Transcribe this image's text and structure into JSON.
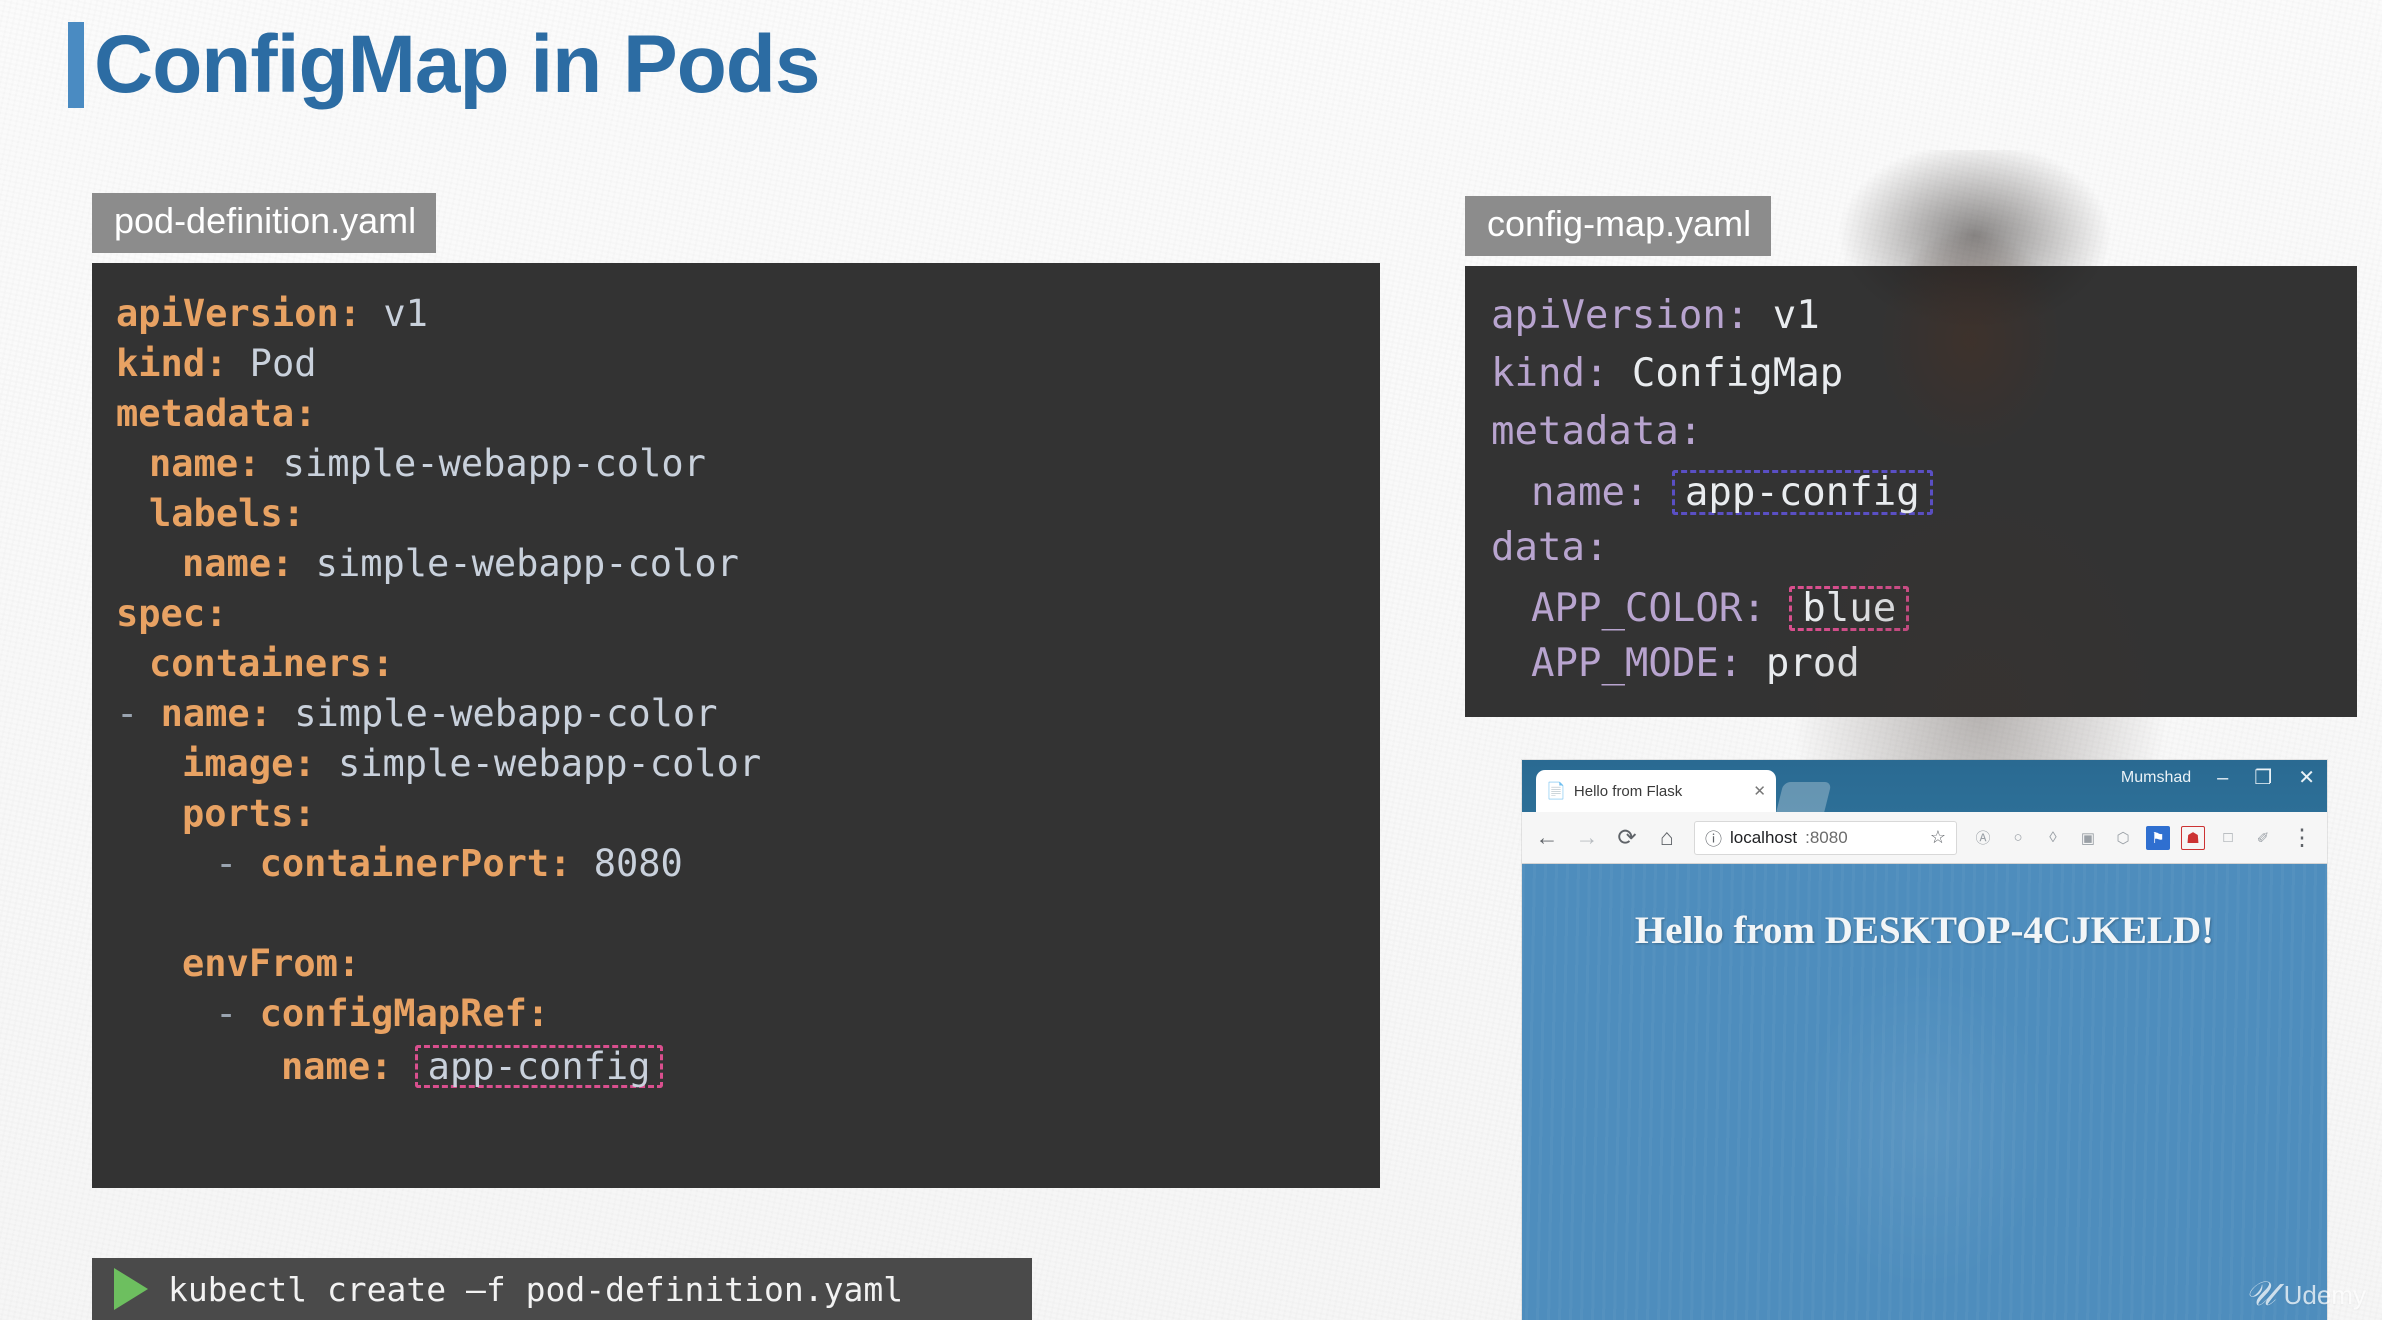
{
  "page_title": "ConfigMap in Pods",
  "accent_color": "#2c6ca3",
  "accent_bar_color": "#4a8bc2",
  "pod_file": {
    "tab_label": "pod-definition.yaml",
    "lines": [
      {
        "indent": 0,
        "dash": "",
        "key": "apiVersion:",
        "value": "v1"
      },
      {
        "indent": 0,
        "dash": "",
        "key": "kind:",
        "value": "Pod"
      },
      {
        "indent": 0,
        "dash": "",
        "key": "metadata:",
        "value": ""
      },
      {
        "indent": 1,
        "dash": "",
        "key": "name:",
        "value": "simple-webapp-color"
      },
      {
        "indent": 1,
        "dash": "",
        "key": "labels:",
        "value": ""
      },
      {
        "indent": 2,
        "dash": "",
        "key": "name:",
        "value": "simple-webapp-color"
      },
      {
        "indent": 0,
        "dash": "",
        "key": "spec:",
        "value": ""
      },
      {
        "indent": 1,
        "dash": "",
        "key": "containers:",
        "value": ""
      },
      {
        "indent": 0,
        "dash": "-",
        "key": "name:",
        "value": "simple-webapp-color"
      },
      {
        "indent": 2,
        "dash": "",
        "key": "image:",
        "value": "simple-webapp-color"
      },
      {
        "indent": 2,
        "dash": "",
        "key": "ports:",
        "value": ""
      },
      {
        "indent": 3,
        "dash": "-",
        "key": "containerPort:",
        "value": "8080"
      },
      {
        "indent": 0,
        "dash": "",
        "key": "",
        "value": ""
      },
      {
        "indent": 2,
        "dash": "",
        "key": "envFrom:",
        "value": ""
      },
      {
        "indent": 3,
        "dash": "-",
        "key": "configMapRef:",
        "value": ""
      },
      {
        "indent": 5,
        "dash": "",
        "key": "name:",
        "value": "app-config",
        "highlight": "pink"
      }
    ]
  },
  "configmap_file": {
    "tab_label": "config-map.yaml",
    "lines": [
      {
        "indent": 0,
        "key": "apiVersion:",
        "value": "v1"
      },
      {
        "indent": 0,
        "key": "kind:",
        "value": "ConfigMap"
      },
      {
        "indent": 0,
        "key": "metadata:",
        "value": ""
      },
      {
        "indent": 1,
        "key": "name:",
        "value": "app-config",
        "highlight": "blue"
      },
      {
        "indent": 0,
        "key": "data:",
        "value": ""
      },
      {
        "indent": 1,
        "key": "APP_COLOR:",
        "value": "blue",
        "highlight": "pink"
      },
      {
        "indent": 1,
        "key": "APP_MODE:",
        "value": "prod"
      }
    ]
  },
  "highlight_colors": {
    "pink": "#d94f8e",
    "blue": "#5a4fc4"
  },
  "browser": {
    "window_user": "Mumshad",
    "minimize_label": "–",
    "maximize_label": "❐",
    "close_label": "✕",
    "tab_title": "Hello from Flask",
    "tab_close_label": "✕",
    "tab_page_icon": "page-icon",
    "back_label": "←",
    "forward_label": "→",
    "reload_label": "⟳",
    "home_label": "⌂",
    "info_label": "ⓘ",
    "url_host": "localhost",
    "url_port": ":8080",
    "bookmark_star_label": "☆",
    "menu_label": "⋮",
    "extensions": [
      {
        "name": "adblock-extension-icon",
        "glyph": "Ⓐ",
        "style": ""
      },
      {
        "name": "circle-extension-icon",
        "glyph": "○",
        "style": ""
      },
      {
        "name": "droplet-extension-icon",
        "glyph": "◊",
        "style": ""
      },
      {
        "name": "screenshot-extension-icon",
        "glyph": "▣",
        "style": ""
      },
      {
        "name": "hexagon-extension-icon",
        "glyph": "⬡",
        "style": ""
      },
      {
        "name": "bookmark-extension-icon",
        "glyph": "⚑",
        "style": "blue"
      },
      {
        "name": "shield-extension-icon",
        "glyph": "☗",
        "style": "red"
      },
      {
        "name": "square-extension-icon",
        "glyph": "□",
        "style": ""
      },
      {
        "name": "note-extension-icon",
        "glyph": "✐",
        "style": ""
      }
    ],
    "page_heading": "Hello from DESKTOP-4CJKELD!",
    "page_background_color": "#4e8dbd"
  },
  "command_bar": {
    "text": "kubectl create –f pod-definition.yaml",
    "play_icon": "play-triangle-icon"
  },
  "watermark": {
    "mark": "𝒰",
    "text": "Udemy"
  }
}
